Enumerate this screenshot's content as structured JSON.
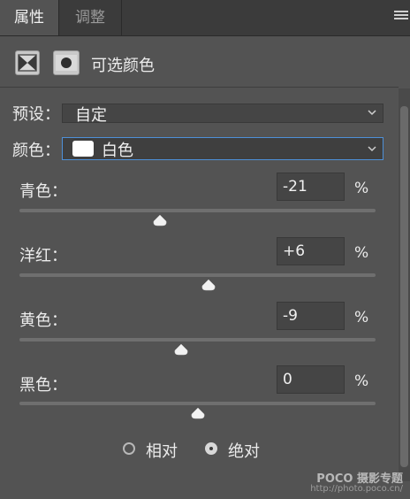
{
  "tabs": {
    "properties": "属性",
    "adjustments": "调整"
  },
  "header": {
    "title": "可选颜色"
  },
  "preset": {
    "label": "预设：",
    "value": "自定"
  },
  "color": {
    "label": "颜色：",
    "value": "白色",
    "swatch": "#ffffff"
  },
  "sliders": [
    {
      "label": "青色：",
      "value": "-21",
      "unit": "%",
      "level": -21
    },
    {
      "label": "洋红：",
      "value": "+6",
      "unit": "%",
      "level": 6
    },
    {
      "label": "黄色：",
      "value": "-9",
      "unit": "%",
      "level": -9
    },
    {
      "label": "黑色：",
      "value": "0",
      "unit": "%",
      "level": 0
    }
  ],
  "method": {
    "relative": "相对",
    "absolute": "绝对",
    "selected": "absolute"
  },
  "watermark": {
    "brand": "POCO 摄影专题",
    "url": "http://photo.poco.cn/"
  },
  "colors": {
    "accent": "#4d90d8",
    "panel": "#535353"
  }
}
